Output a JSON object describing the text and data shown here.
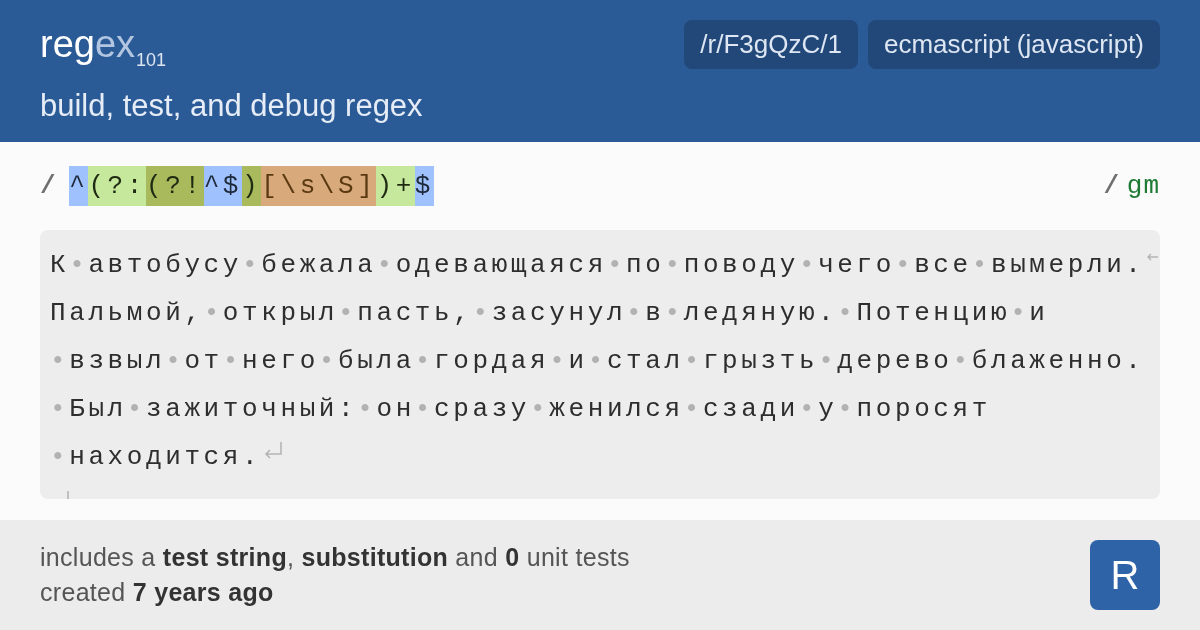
{
  "header": {
    "logo": {
      "text": "reg",
      "faded_text": "ex",
      "subscript": "101"
    },
    "tagline": "build, test, and debug regex",
    "badges": [
      "/r/F3gQzC/1",
      "ecmascript (javascript)"
    ]
  },
  "regex": {
    "opening_delimiter": "/",
    "tokens": [
      {
        "text": "^",
        "kind": "anchor"
      },
      {
        "text": "(?:",
        "kind": "group"
      },
      {
        "text": "(?!",
        "kind": "lookahead"
      },
      {
        "text": "^$",
        "kind": "anchor"
      },
      {
        "text": ")",
        "kind": "lookahead"
      },
      {
        "text": "[\\s\\S]",
        "kind": "class"
      },
      {
        "text": ")+",
        "kind": "group"
      },
      {
        "text": "$",
        "kind": "anchor"
      }
    ],
    "closing_delimiter": "/",
    "flags": "gm"
  },
  "test_string": {
    "lines": [
      {
        "end_mark": {
          "kind": "return_cut_right"
        },
        "segments": [
          {
            "kind": "text",
            "text": "К"
          },
          {
            "kind": "space",
            "text": "•"
          },
          {
            "kind": "text",
            "text": "автобусу"
          },
          {
            "kind": "space",
            "text": "•"
          },
          {
            "kind": "text",
            "text": "бежала"
          },
          {
            "kind": "space",
            "text": "•"
          },
          {
            "kind": "text",
            "text": "одевающаяся"
          },
          {
            "kind": "space",
            "text": "•"
          },
          {
            "kind": "text",
            "text": "по"
          },
          {
            "kind": "space",
            "text": "•"
          },
          {
            "kind": "text",
            "text": "поводу"
          },
          {
            "kind": "space",
            "text": "•"
          },
          {
            "kind": "text",
            "text": "чего"
          },
          {
            "kind": "space",
            "text": "•"
          },
          {
            "kind": "text",
            "text": "все"
          },
          {
            "kind": "space",
            "text": "•"
          },
          {
            "kind": "text",
            "text": "вымерли."
          }
        ]
      },
      {
        "segments": [
          {
            "kind": "text",
            "text": "Пальмой,"
          },
          {
            "kind": "space",
            "text": "•"
          },
          {
            "kind": "text",
            "text": "открыл"
          },
          {
            "kind": "space",
            "text": "•"
          },
          {
            "kind": "text",
            "text": "пасть,"
          },
          {
            "kind": "space",
            "text": "•"
          },
          {
            "kind": "text",
            "text": "засунул"
          },
          {
            "kind": "space",
            "text": "•"
          },
          {
            "kind": "text",
            "text": "в"
          },
          {
            "kind": "space",
            "text": "•"
          },
          {
            "kind": "text",
            "text": "ледяную."
          },
          {
            "kind": "space",
            "text": "•"
          },
          {
            "kind": "text",
            "text": "Потенцию"
          },
          {
            "kind": "space",
            "text": "•"
          },
          {
            "kind": "text",
            "text": "и"
          }
        ]
      },
      {
        "segments": [
          {
            "kind": "space",
            "text": "•"
          },
          {
            "kind": "text",
            "text": "взвыл"
          },
          {
            "kind": "space",
            "text": "•"
          },
          {
            "kind": "text",
            "text": "от"
          },
          {
            "kind": "space",
            "text": "•"
          },
          {
            "kind": "text",
            "text": "него"
          },
          {
            "kind": "space",
            "text": "•"
          },
          {
            "kind": "text",
            "text": "была"
          },
          {
            "kind": "space",
            "text": "•"
          },
          {
            "kind": "text",
            "text": "гордая"
          },
          {
            "kind": "space",
            "text": "•"
          },
          {
            "kind": "text",
            "text": "и"
          },
          {
            "kind": "space",
            "text": "•"
          },
          {
            "kind": "text",
            "text": "стал"
          },
          {
            "kind": "space",
            "text": "•"
          },
          {
            "kind": "text",
            "text": "грызть"
          },
          {
            "kind": "space",
            "text": "•"
          },
          {
            "kind": "text",
            "text": "дерево"
          },
          {
            "kind": "space",
            "text": "•"
          },
          {
            "kind": "text",
            "text": "блаженно."
          }
        ]
      },
      {
        "segments": [
          {
            "kind": "space",
            "text": "•"
          },
          {
            "kind": "text",
            "text": "Был"
          },
          {
            "kind": "space",
            "text": "•"
          },
          {
            "kind": "text",
            "text": "зажиточный:"
          },
          {
            "kind": "space",
            "text": "•"
          },
          {
            "kind": "text",
            "text": "он"
          },
          {
            "kind": "space",
            "text": "•"
          },
          {
            "kind": "text",
            "text": "сразу"
          },
          {
            "kind": "space",
            "text": "•"
          },
          {
            "kind": "text",
            "text": "женился"
          },
          {
            "kind": "space",
            "text": "•"
          },
          {
            "kind": "text",
            "text": "сзади"
          },
          {
            "kind": "space",
            "text": "•"
          },
          {
            "kind": "text",
            "text": "у"
          },
          {
            "kind": "space",
            "text": "•"
          },
          {
            "kind": "text",
            "text": "поросят"
          }
        ]
      },
      {
        "end_mark": {
          "kind": "return"
        },
        "segments": [
          {
            "kind": "space",
            "text": "•"
          },
          {
            "kind": "text",
            "text": "находится."
          }
        ]
      },
      {
        "end_mark": {
          "kind": "return_cut_bottom"
        }
      }
    ]
  },
  "footer": {
    "summary": "includes a **test string**, **substitution** and **0** unit tests",
    "created": "created **7 years ago**",
    "avatar": "R"
  }
}
